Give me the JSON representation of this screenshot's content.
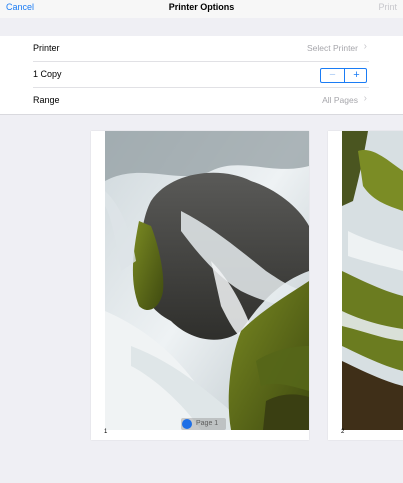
{
  "nav": {
    "cancel": "Cancel",
    "title": "Printer Options",
    "print": "Print"
  },
  "options": {
    "printer": {
      "label": "Printer",
      "value": "Select Printer"
    },
    "copies": {
      "label": "1 Copy",
      "minus": "−",
      "plus": "+"
    },
    "range": {
      "label": "Range",
      "value": "All Pages"
    }
  },
  "preview": {
    "pages": [
      {
        "number": "1"
      },
      {
        "number": "2"
      }
    ],
    "badge": "Page 1"
  },
  "colors": {
    "accent": "#1a7cf5",
    "background": "#efeff4"
  }
}
